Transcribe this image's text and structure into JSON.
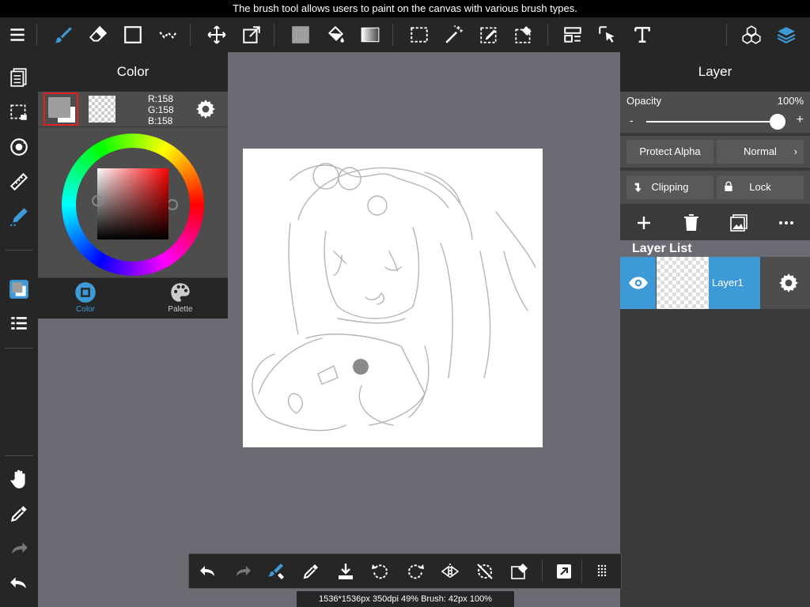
{
  "tooltip": "The brush tool allows users to paint on the canvas with various brush types.",
  "colors": {
    "accent": "#3d9ad6",
    "toolbar_bg": "#262626",
    "panel_bg": "#3a3a3a",
    "canvas_bg": "#6b6c73"
  },
  "toolbar": {
    "icons": [
      "menu-icon",
      "brush-icon",
      "eraser-icon",
      "rectangle-icon",
      "dot-icon",
      "move-icon",
      "transform-icon",
      "fill-color-icon",
      "bucket-icon",
      "gradient-icon",
      "select-rect-icon",
      "magic-wand-icon",
      "select-pen-icon",
      "select-eraser-icon",
      "layout-icon",
      "select-cursor-icon",
      "text-icon",
      "materials-icon",
      "layers-icon"
    ],
    "active_tool": "brush-icon"
  },
  "color_panel": {
    "title": "Color",
    "rgb": {
      "r": "R:158",
      "g": "G:158",
      "b": "B:158"
    },
    "current_color": "#9e9e9e",
    "tabs": [
      {
        "label": "Color",
        "active": true
      },
      {
        "label": "Palette",
        "active": false
      }
    ]
  },
  "layer_panel": {
    "title": "Layer",
    "opacity_label": "Opacity",
    "opacity_value": "100%",
    "opacity_fraction": 1.0,
    "minus": "-",
    "plus": "+",
    "protect_alpha": "Protect Alpha",
    "blend_mode": "Normal",
    "clipping": "Clipping",
    "lock": "Lock",
    "layer_list_title": "Layer List",
    "layers": [
      {
        "name": "Layer1",
        "visible": true
      }
    ]
  },
  "status": "1536*1536px 350dpi 49% Brush: 42px 100%"
}
